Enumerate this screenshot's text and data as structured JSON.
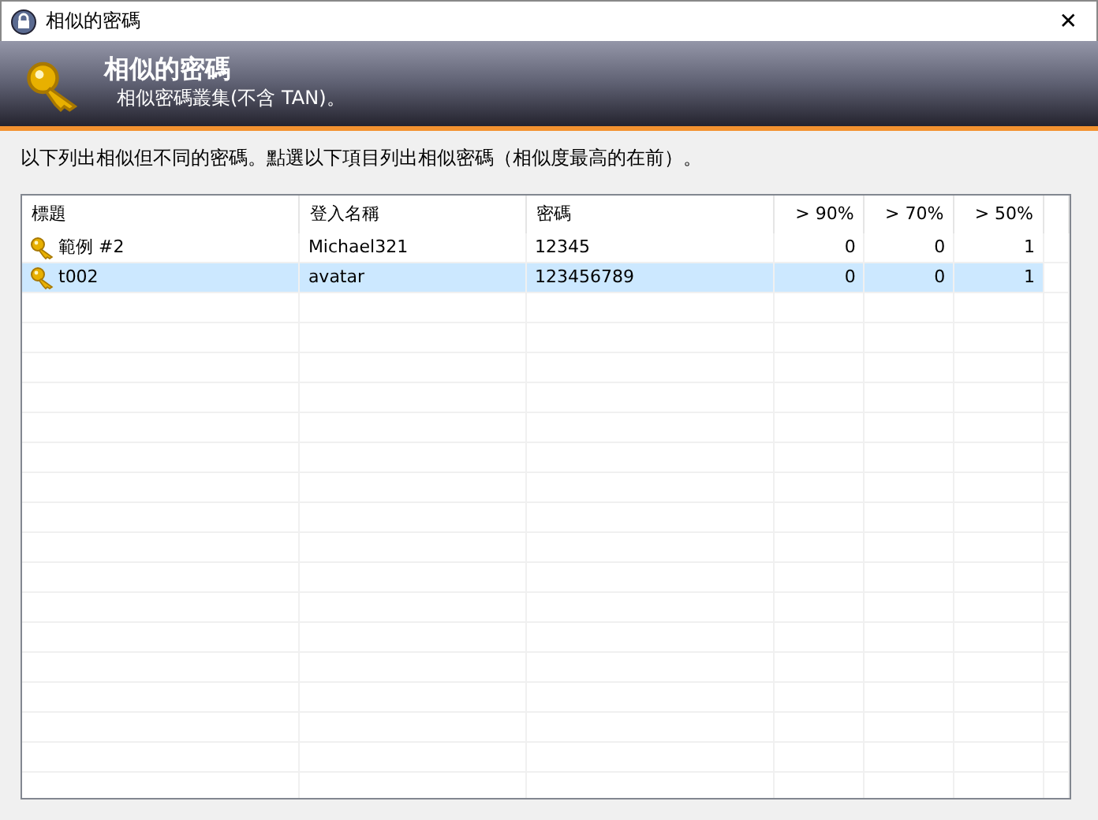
{
  "window": {
    "title": "相似的密碼",
    "close": "✕"
  },
  "banner": {
    "title": "相似的密碼",
    "subtitle": "相似密碼叢集(不含 TAN)。"
  },
  "instruction": "以下列出相似但不同的密碼。點選以下項目列出相似密碼（相似度最高的在前）。",
  "table": {
    "columns": [
      "標題",
      "登入名稱",
      "密碼",
      "> 90%",
      "> 70%",
      "> 50%"
    ],
    "rows": [
      {
        "cells": [
          "範例 #2",
          "Michael321",
          "12345",
          "0",
          "0",
          "1"
        ],
        "selected": false
      },
      {
        "cells": [
          "t002",
          "avatar",
          "123456789",
          "0",
          "0",
          "1"
        ],
        "selected": true
      }
    ]
  }
}
